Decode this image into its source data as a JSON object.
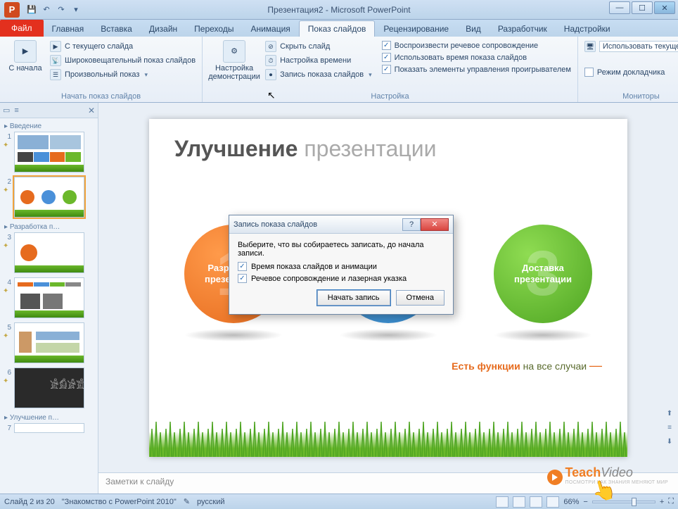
{
  "window": {
    "app_letter": "P",
    "title": "Презентация2 - Microsoft PowerPoint"
  },
  "tabs": {
    "file": "Файл",
    "home": "Главная",
    "insert": "Вставка",
    "design": "Дизайн",
    "transitions": "Переходы",
    "animation": "Анимация",
    "slideshow": "Показ слайдов",
    "review": "Рецензирование",
    "view": "Вид",
    "developer": "Разработчик",
    "addins": "Надстройки"
  },
  "ribbon": {
    "group_start": "Начать показ слайдов",
    "from_beginning": "С начала",
    "from_current": "С текущего слайда",
    "broadcast": "Широковещательный показ слайдов",
    "custom_show": "Произвольный показ",
    "setup_btn": "Настройка демонстрации",
    "hide_slide": "Скрыть слайд",
    "rehearse": "Настройка времени",
    "record": "Запись показа слайдов",
    "play_narr": "Воспроизвести речевое сопровождение",
    "use_timings": "Использовать время показа слайдов",
    "show_controls": "Показать элементы управления проигрывателем",
    "group_setup": "Настройка",
    "monitor_combo": "Использовать текуще…",
    "presenter_view": "Режим докладчика",
    "group_monitors": "Мониторы"
  },
  "outline": {
    "section1": "Введение",
    "section2": "Разработка п…",
    "section3": "Улучшение п…"
  },
  "slide": {
    "title_a": "Улучшение",
    "title_b": "презентации",
    "c1_line1": "Разработка",
    "c1_line2": "презентации",
    "c3_line1": "Доставка",
    "c3_line2": "презентации",
    "tagline_a": "Есть функции",
    "tagline_b": "на все случаи"
  },
  "dialog": {
    "title": "Запись показа слайдов",
    "instruction": "Выберите, что вы собираетесь записать, до начала записи.",
    "opt1": "Время показа слайдов и анимации",
    "opt2": "Речевое сопровождение и лазерная указка",
    "start": "Начать запись",
    "cancel": "Отмена"
  },
  "notes": {
    "placeholder": "Заметки к слайду"
  },
  "status": {
    "slide": "Слайд 2 из 20",
    "theme": "\"Знакомство с PowerPoint 2010\"",
    "lang": "русский",
    "zoom": "66%"
  },
  "branding": {
    "teach": "Teach",
    "video": "Video",
    "sub": "ПОСМОТРИ КАК ЗНАНИЯ МЕНЯЮТ МИР"
  },
  "thumb_nums": [
    "1",
    "2",
    "3",
    "4",
    "5",
    "6",
    "7"
  ]
}
